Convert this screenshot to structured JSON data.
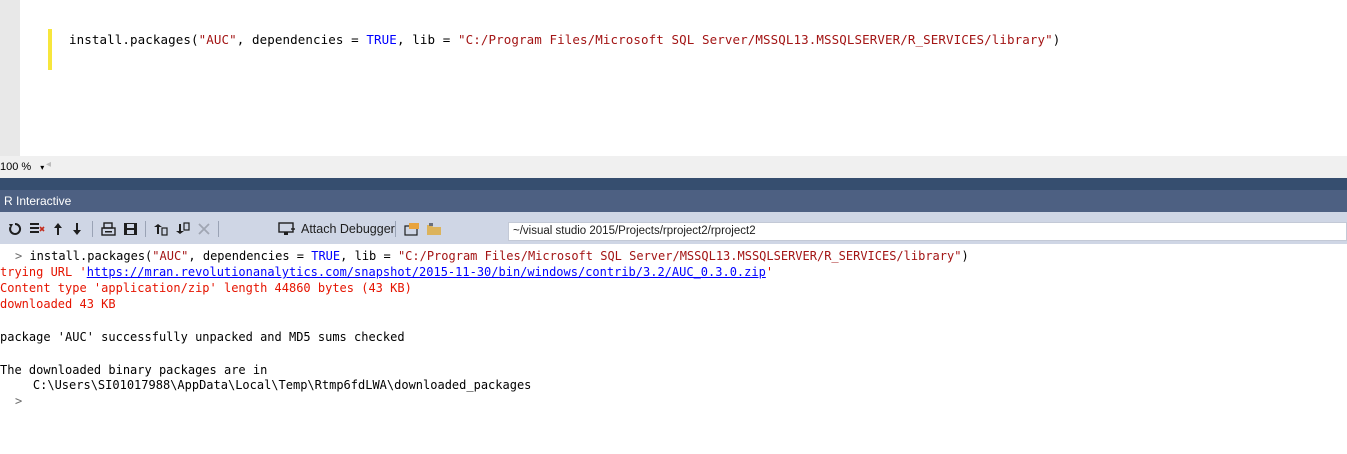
{
  "editor": {
    "code": {
      "fn": "install.packages(",
      "arg_pkg": "\"AUC\"",
      "mid": ", dependencies = ",
      "true_kw": "TRUE",
      "lib_part": ", lib = ",
      "lib_path": "\"C:/Program Files/Microsoft SQL Server/MSSQL13.MSSQLSERVER/R_SERVICES/library\"",
      "close": ")"
    }
  },
  "zoom": {
    "value": "100 %",
    "arrow": "▾",
    "scroll_left": "◂"
  },
  "tool_window": {
    "title": "R Interactive"
  },
  "toolbar": {
    "attach_label": "Attach Debugger",
    "working_dir": "~/visual studio 2015/Projects/rproject2/rproject2"
  },
  "console": {
    "prompt": ">",
    "cmd": {
      "fn": " install.packages(",
      "pkg": "\"AUC\"",
      "mid": ", dependencies = ",
      "true_kw": "TRUE",
      "lib_part": ", lib = ",
      "path": "\"C:/Program Files/Microsoft SQL Server/MSSQL13.MSSQLSERVER/R_SERVICES/library\"",
      "close": ")"
    },
    "trying_prefix": "trying URL '",
    "trying_url": "https://mran.revolutionanalytics.com/snapshot/2015-11-30/bin/windows/contrib/3.2/AUC_0.3.0.zip",
    "trying_suffix": "'",
    "content_type": "Content type 'application/zip' length 44860 bytes (43 KB)",
    "downloaded": "downloaded 43 KB",
    "unpacked": "package 'AUC' successfully unpacked and MD5 sums checked",
    "binary_line": "The downloaded binary packages are in",
    "binary_path": "    C:\\Users\\SI01017988\\AppData\\Local\\Temp\\Rtmp6fdLWA\\downloaded_packages",
    "final_prompt": ">"
  }
}
